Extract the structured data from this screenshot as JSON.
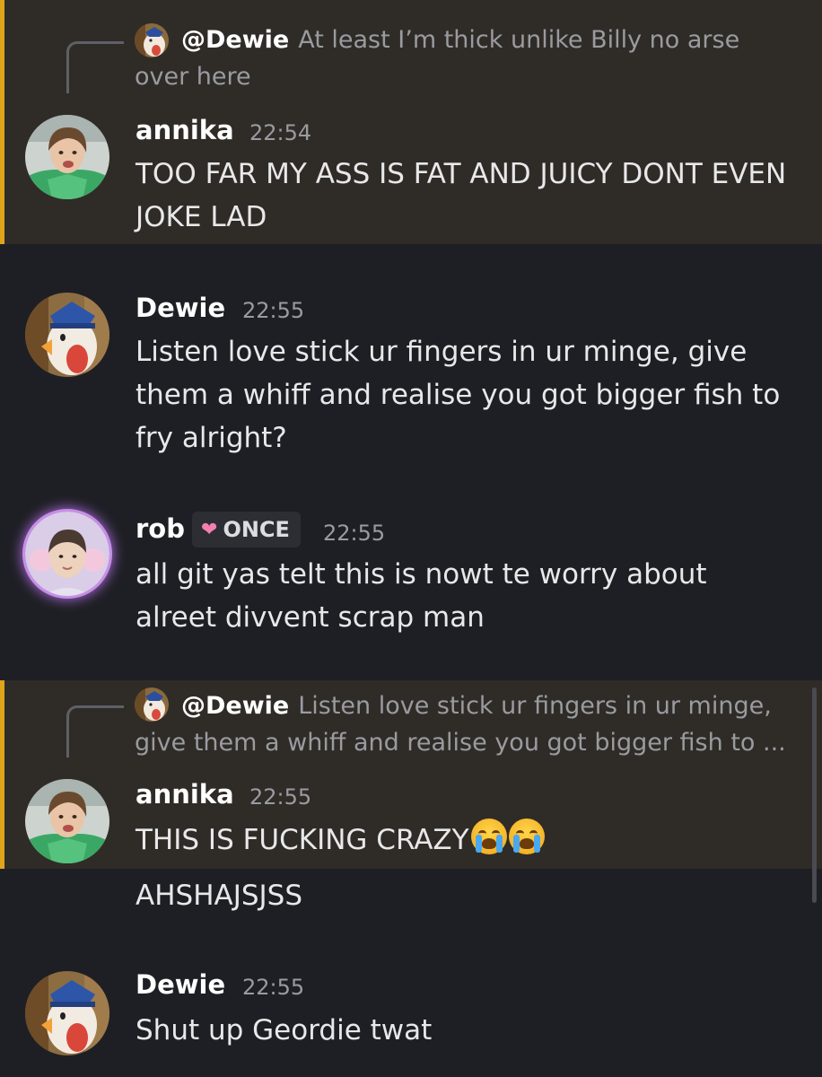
{
  "messages": [
    {
      "reply": {
        "name": "@Dewie",
        "text": "At least I’m thick unlike Billy no arse over here"
      },
      "author": "annika",
      "time": "22:54",
      "text": "TOO FAR MY ASS IS FAT AND JUICY DONT EVEN JOKE LAD",
      "highlighted": true
    },
    {
      "author": "Dewie",
      "time": "22:55",
      "text": "Listen love stick ur fingers in ur minge, give them a whiff and realise you got bigger fish to fry alright?"
    },
    {
      "author": "rob",
      "badge": "ONCE",
      "time": "22:55",
      "text": "all git yas telt this is nowt te worry about alreet divvent scrap man"
    },
    {
      "reply": {
        "name": "@Dewie",
        "text": "Listen love stick ur fingers in ur minge, give them a whiff and realise you got bigger fish to ..."
      },
      "author": "annika",
      "time": "22:55",
      "text": "THIS IS FUCKING CRAZY",
      "emojis": [
        "loudly-crying-face",
        "loudly-crying-face"
      ],
      "highlighted": true
    },
    {
      "author": "annika",
      "text": "AHSHAJSJSS",
      "continuation": true
    },
    {
      "author": "Dewie",
      "time": "22:55",
      "text": "Shut up Geordie twat"
    }
  ],
  "colors": {
    "background": "#1e1f24",
    "highlight_background": "#2f2c27",
    "highlight_bar": "#e0a31c",
    "muted_text": "#9a9ba1",
    "badge_heart": "#f47fb2"
  }
}
